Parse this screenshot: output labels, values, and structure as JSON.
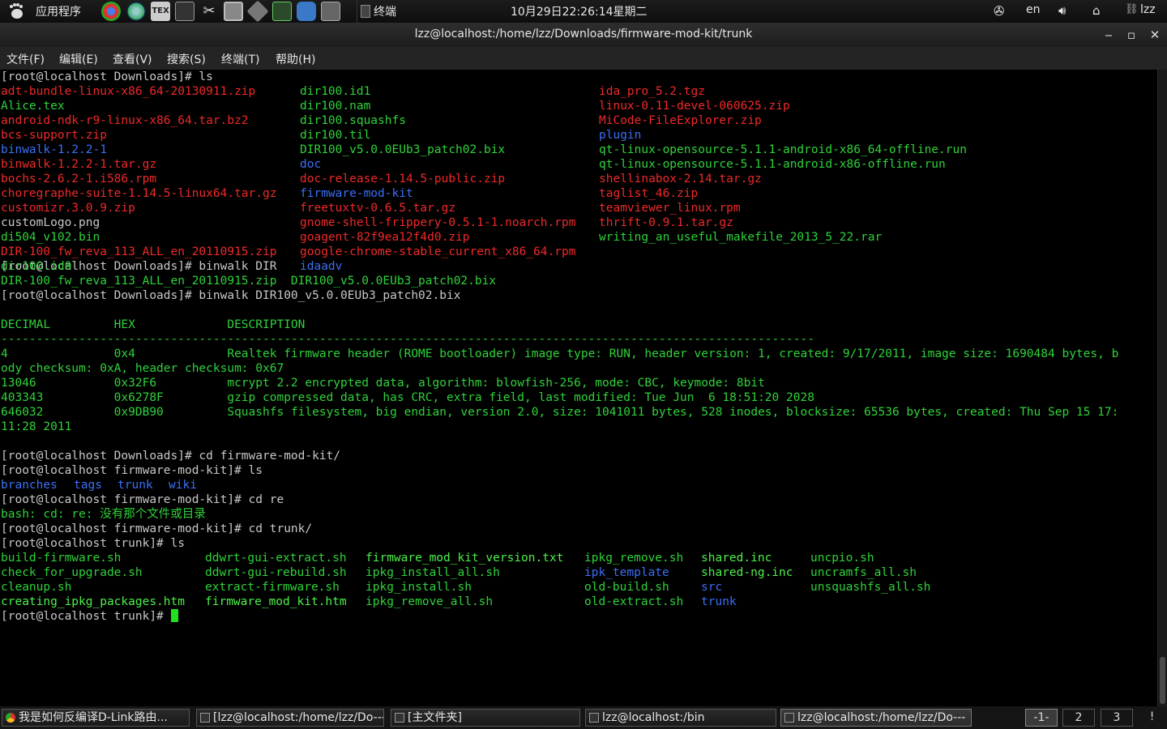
{
  "top_panel": {
    "apps_menu": "应用程序",
    "terminal_task": "终端",
    "clock": "10月29日22:26:14星期二",
    "language": "en",
    "user": "lzz"
  },
  "window": {
    "title": "lzz@localhost:/home/lzz/Downloads/firmware-mod-kit/trunk"
  },
  "menu": [
    "文件(F)",
    "编辑(E)",
    "查看(V)",
    "搜索(S)",
    "终端(T)",
    "帮助(H)"
  ],
  "terminal": {
    "lines": [
      {
        "text": "[root@localhost Downloads]# ls",
        "color": "#c8c8c8"
      },
      {
        "text": "",
        "color": "#c8c8c8"
      },
      {
        "text": "",
        "color": "#c8c8c8"
      },
      {
        "text": "",
        "color": "#c8c8c8"
      },
      {
        "text": "",
        "color": "#c8c8c8"
      },
      {
        "text": "",
        "color": "#c8c8c8"
      },
      {
        "text": "",
        "color": "#c8c8c8"
      },
      {
        "text": "",
        "color": "#c8c8c8"
      },
      {
        "text": "",
        "color": "#c8c8c8"
      },
      {
        "text": "",
        "color": "#c8c8c8"
      },
      {
        "text": "",
        "color": "#c8c8c8"
      },
      {
        "text": "",
        "color": "#c8c8c8"
      },
      {
        "text": "",
        "color": "#c8c8c8"
      },
      {
        "text": "[root@localhost Downloads]# binwalk DIR",
        "color": "#c8c8c8"
      },
      {
        "text": "DIR-100_fw_reva_113_ALL_en_20110915.zip  DIR100_v5.0.0EUb3_patch02.bix",
        "color": "#2fd23a"
      },
      {
        "text": "[root@localhost Downloads]# binwalk DIR100_v5.0.0EUb3_patch02.bix",
        "color": "#c8c8c8"
      },
      {
        "text": "",
        "color": "#2fd23a"
      },
      {
        "text": "DECIMAL         HEX             DESCRIPTION",
        "color": "#2fd23a"
      },
      {
        "text": "-------------------------------------------------------------------------------------------------------------------",
        "color": "#2fd23a"
      },
      {
        "text": "4               0x4             Realtek firmware header (ROME bootloader) image type: RUN, header version: 1, created: 9/17/2011, image size: 1690484 bytes, b",
        "color": "#2fd23a"
      },
      {
        "text": "ody checksum: 0xA, header checksum: 0x67",
        "color": "#2fd23a"
      },
      {
        "text": "13046           0x32F6          mcrypt 2.2 encrypted data, algorithm: blowfish-256, mode: CBC, keymode: 8bit",
        "color": "#2fd23a"
      },
      {
        "text": "403343          0x6278F         gzip compressed data, has CRC, extra field, last modified: Tue Jun  6 18:51:20 2028",
        "color": "#2fd23a"
      },
      {
        "text": "646032          0x9DB90         Squashfs filesystem, big endian, version 2.0, size: 1041011 bytes, 528 inodes, blocksize: 65536 bytes, created: Thu Sep 15 17:",
        "color": "#2fd23a"
      },
      {
        "text": "11:28 2011",
        "color": "#2fd23a"
      },
      {
        "text": "",
        "color": "#2fd23a"
      },
      {
        "text": "[root@localhost Downloads]# cd firmware-mod-kit/",
        "color": "#c8c8c8"
      },
      {
        "text": "[root@localhost firmware-mod-kit]# ls",
        "color": "#c8c8c8"
      },
      {
        "text": "",
        "color": "#c8c8c8"
      },
      {
        "text": "[root@localhost firmware-mod-kit]# cd re",
        "color": "#c8c8c8"
      },
      {
        "text": "bash: cd: re: 没有那个文件或目录",
        "color": "#2fd23a"
      },
      {
        "text": "[root@localhost firmware-mod-kit]# cd trunk/",
        "color": "#c8c8c8"
      },
      {
        "text": "[root@localhost trunk]# ls",
        "color": "#c8c8c8"
      },
      {
        "text": "",
        "color": "#c8c8c8"
      },
      {
        "text": "",
        "color": "#c8c8c8"
      },
      {
        "text": "",
        "color": "#c8c8c8"
      },
      {
        "text": "",
        "color": "#c8c8c8"
      },
      {
        "text": "[root@localhost trunk]# ",
        "color": "#c8c8c8"
      }
    ],
    "ls_downloads": {
      "col1": [
        {
          "name": "adt-bundle-linux-x86_64-20130911.zip",
          "kind": "red"
        },
        {
          "name": "Alice.tex",
          "kind": "grn"
        },
        {
          "name": "android-ndk-r9-linux-x86_64.tar.bz2",
          "kind": "red"
        },
        {
          "name": "bcs-support.zip",
          "kind": "red"
        },
        {
          "name": "binwalk-1.2.2-1",
          "kind": "blu"
        },
        {
          "name": "binwalk-1.2.2-1.tar.gz",
          "kind": "red"
        },
        {
          "name": "bochs-2.6.2-1.i586.rpm",
          "kind": "red"
        },
        {
          "name": "choregraphe-suite-1.14.5-linux64.tar.gz",
          "kind": "red"
        },
        {
          "name": "customizr.3.0.9.zip",
          "kind": "red"
        },
        {
          "name": "customLogo.png",
          "kind": "gry"
        },
        {
          "name": "di504_v102.bin",
          "kind": "grn"
        },
        {
          "name": "DIR-100_fw_reva_113_ALL_en_20110915.zip",
          "kind": "red"
        },
        {
          "name": "dir100.id0",
          "kind": "grn"
        }
      ],
      "col2": [
        {
          "name": "dir100.id1",
          "kind": "grn"
        },
        {
          "name": "dir100.nam",
          "kind": "grn"
        },
        {
          "name": "dir100.squashfs",
          "kind": "grn"
        },
        {
          "name": "dir100.til",
          "kind": "grn"
        },
        {
          "name": "DIR100_v5.0.0EUb3_patch02.bix",
          "kind": "grn"
        },
        {
          "name": "doc",
          "kind": "blu"
        },
        {
          "name": "doc-release-1.14.5-public.zip",
          "kind": "red"
        },
        {
          "name": "firmware-mod-kit",
          "kind": "blu"
        },
        {
          "name": "freetuxtv-0.6.5.tar.gz",
          "kind": "red"
        },
        {
          "name": "gnome-shell-frippery-0.5.1-1.noarch.rpm",
          "kind": "red"
        },
        {
          "name": "goagent-82f9ea12f4d0.zip",
          "kind": "red"
        },
        {
          "name": "google-chrome-stable_current_x86_64.rpm",
          "kind": "red"
        },
        {
          "name": "idaadv",
          "kind": "blu"
        }
      ],
      "col3": [
        {
          "name": "ida_pro_5.2.tgz",
          "kind": "red"
        },
        {
          "name": "linux-0.11-devel-060625.zip",
          "kind": "red"
        },
        {
          "name": "MiCode-FileExplorer.zip",
          "kind": "red"
        },
        {
          "name": "plugin",
          "kind": "blu"
        },
        {
          "name": "qt-linux-opensource-5.1.1-android-x86_64-offline.run",
          "kind": "grn"
        },
        {
          "name": "qt-linux-opensource-5.1.1-android-x86-offline.run",
          "kind": "grn"
        },
        {
          "name": "shellinabox-2.14.tar.gz",
          "kind": "red"
        },
        {
          "name": "taglist_46.zip",
          "kind": "red"
        },
        {
          "name": "teamviewer_linux.rpm",
          "kind": "red"
        },
        {
          "name": "thrift-0.9.1.tar.gz",
          "kind": "red"
        },
        {
          "name": "writing_an_useful_makefile_2013_5_22.rar",
          "kind": "grn"
        }
      ]
    },
    "ls_fmk": [
      {
        "name": "branches",
        "kind": "blu"
      },
      {
        "name": "tags",
        "kind": "blu"
      },
      {
        "name": "trunk",
        "kind": "blu"
      },
      {
        "name": "wiki",
        "kind": "blu"
      }
    ],
    "ls_trunk": {
      "c1": [
        {
          "name": "build-firmware.sh",
          "kind": "grn"
        },
        {
          "name": "check_for_upgrade.sh",
          "kind": "grn"
        },
        {
          "name": "cleanup.sh",
          "kind": "grn"
        },
        {
          "name": "creating_ipkg_packages.htm",
          "kind": "bgrn"
        }
      ],
      "c2": [
        {
          "name": "ddwrt-gui-extract.sh",
          "kind": "grn"
        },
        {
          "name": "ddwrt-gui-rebuild.sh",
          "kind": "grn"
        },
        {
          "name": "extract-firmware.sh",
          "kind": "grn"
        },
        {
          "name": "firmware_mod_kit.htm",
          "kind": "bgrn"
        }
      ],
      "c3": [
        {
          "name": "firmware_mod_kit_version.txt",
          "kind": "bgrn"
        },
        {
          "name": "ipkg_install_all.sh",
          "kind": "grn"
        },
        {
          "name": "ipkg_install.sh",
          "kind": "grn"
        },
        {
          "name": "ipkg_remove_all.sh",
          "kind": "grn"
        }
      ],
      "c4": [
        {
          "name": "ipkg_remove.sh",
          "kind": "grn"
        },
        {
          "name": "ipk_template",
          "kind": "blu"
        },
        {
          "name": "old-build.sh",
          "kind": "grn"
        },
        {
          "name": "old-extract.sh",
          "kind": "grn"
        }
      ],
      "c5": [
        {
          "name": "shared.inc",
          "kind": "bgrn"
        },
        {
          "name": "shared-ng.inc",
          "kind": "bgrn"
        },
        {
          "name": "src",
          "kind": "blu"
        },
        {
          "name": "trunk",
          "kind": "blu"
        }
      ],
      "c6": [
        {
          "name": "uncpio.sh",
          "kind": "grn"
        },
        {
          "name": "uncramfs_all.sh",
          "kind": "grn"
        },
        {
          "name": "unsquashfs_all.sh",
          "kind": "grn"
        }
      ]
    }
  },
  "taskbar": {
    "tasks": [
      {
        "label": "我是如何反编译D-Link路由...",
        "icon": "chrome"
      },
      {
        "label": "[lzz@localhost:/home/lzz/Do---",
        "icon": "term"
      },
      {
        "label": "[主文件夹]",
        "icon": "folder"
      },
      {
        "label": "lzz@localhost:/bin",
        "icon": "term"
      },
      {
        "label": "lzz@localhost:/home/lzz/Do---",
        "icon": "term"
      }
    ],
    "workspaces": [
      "-1-",
      "2",
      "3"
    ],
    "notify": "!"
  },
  "colors": {
    "red": "#ef2929",
    "green": "#2fd23a",
    "bright_green": "#4ef04a",
    "blue": "#3b6ff5",
    "gray": "#c8c8c8"
  }
}
